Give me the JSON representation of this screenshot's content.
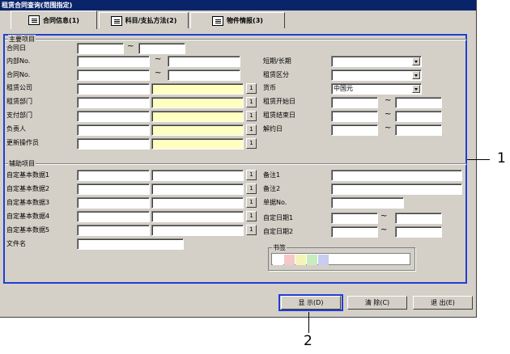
{
  "window": {
    "title": "租赁合同查询(范围指定)"
  },
  "tabs": [
    {
      "label": "合同信息(1)",
      "icon": "book-icon"
    },
    {
      "label": "科目/支払方法(2)",
      "icon": "document-icon"
    },
    {
      "label": "物件情报(3)",
      "icon": "screen-icon"
    }
  ],
  "main_group": {
    "label": "主要项目",
    "contract_date": "合同日",
    "internal_no": "内部No.",
    "contract_no": "合同No.",
    "lease_company": "租赁公司",
    "lease_dept": "租赁部门",
    "pay_dept": "支付部门",
    "person": "负责人",
    "updater": "更新操作员",
    "term": "短期/长期",
    "lease_type": "租赁区分",
    "currency": "货币",
    "currency_value": "中国元",
    "start_date": "租赁开始日",
    "end_date": "租赁结束日",
    "cancel_date": "解约日"
  },
  "aux_group": {
    "label": "辅助项目",
    "custom_nums": [
      "自定基本数据1",
      "自定基本数据2",
      "自定基本数据3",
      "自定基本数据4",
      "自定基本数据5"
    ],
    "file_name": "文件名",
    "note1": "备注1",
    "note2": "备注2",
    "doc_no": "单据No.",
    "custom_date1": "自定日期1",
    "custom_date2": "自定日期2",
    "bookmark": "书签"
  },
  "common": {
    "tilde": "~",
    "select_btn": "1"
  },
  "buttons": {
    "show": "显 示(D)",
    "clear": "清 除(C)",
    "exit": "退 出(E)"
  },
  "callouts": {
    "one": "1",
    "two": "2"
  },
  "colors": {
    "highlight": "#1f3fd0",
    "required_field": "#ffffc0",
    "title_bar": "#0a246a"
  },
  "bookmark_colors": [
    "#ffffff",
    "#f4c8c8",
    "#f4f4b8",
    "#c8ecc0",
    "#c8ccf0"
  ]
}
